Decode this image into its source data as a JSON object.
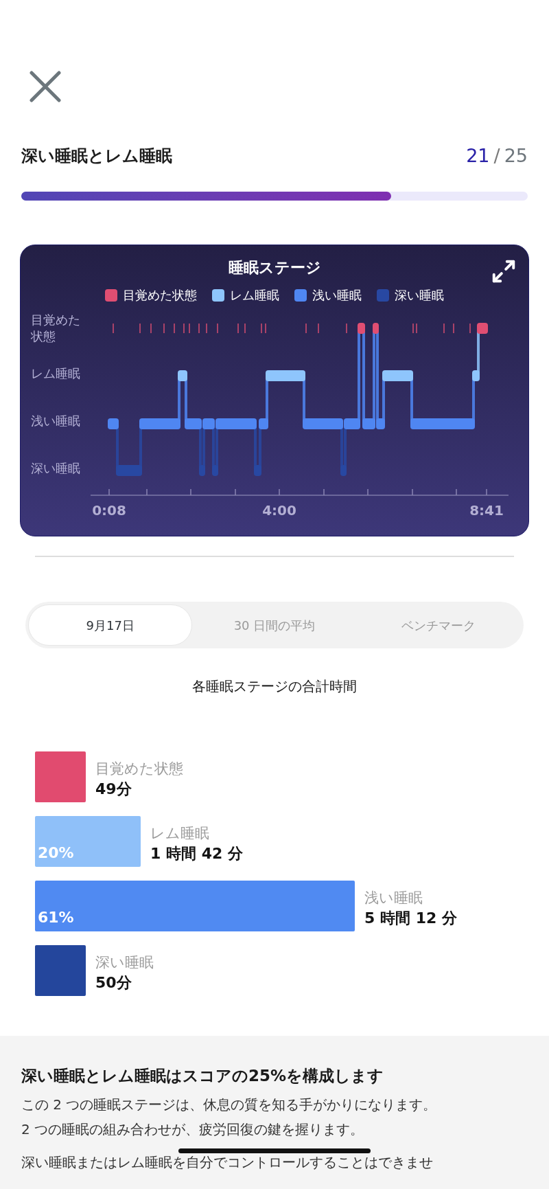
{
  "header": {
    "title": "深い睡眠とレム睡眠",
    "score": "21",
    "separator": "/",
    "total": "25",
    "progress": {
      "level": 0.73
    }
  },
  "chart_card": {
    "title": "睡眠ステージ",
    "legend": [
      {
        "label": "目覚めた状態",
        "color": "#e04e72"
      },
      {
        "label": "レム睡眠",
        "color": "#8ec5fc"
      },
      {
        "label": "浅い睡眠",
        "color": "#4f86f2"
      },
      {
        "label": "深い睡眠",
        "color": "#2848a2"
      }
    ],
    "y_labels": [
      "目覚めた状態",
      "レム睡眠",
      "浅い睡眠",
      "深い睡眠"
    ],
    "x_labels": [
      "0:08",
      "4:00",
      "8:41"
    ]
  },
  "tabs": [
    {
      "label": "9月17日",
      "selected": true
    },
    {
      "label": "30 日間の平均",
      "selected": false
    },
    {
      "label": "ベンチマーク",
      "selected": false
    }
  ],
  "totals": {
    "title": "各睡眠ステージの合計時間",
    "stages": [
      {
        "label": "目覚めた状態",
        "duration": "49分",
        "color": "#e14b6f"
      },
      {
        "label": "レム睡眠",
        "duration": "1 時間 42 分",
        "percent": "20%",
        "color": "#8fc0f9"
      },
      {
        "label": "浅い睡眠",
        "duration": "5 時間 12 分",
        "percent": "61%",
        "color": "#508af2"
      },
      {
        "label": "深い睡眠",
        "duration": "50分",
        "color": "#24469c"
      }
    ]
  },
  "info": {
    "heading": "深い睡眠とレム睡眠はスコアの25%を構成します",
    "lines": [
      "この 2 つの睡眠ステージは、休息の質を知る手がかりになります。",
      "2 つの睡眠の組み合わせが、疲労回復の鍵を握ります。"
    ],
    "next_paragraph": "深い睡眠またはレム睡眠を自分でコントロールすることはできませ"
  }
}
